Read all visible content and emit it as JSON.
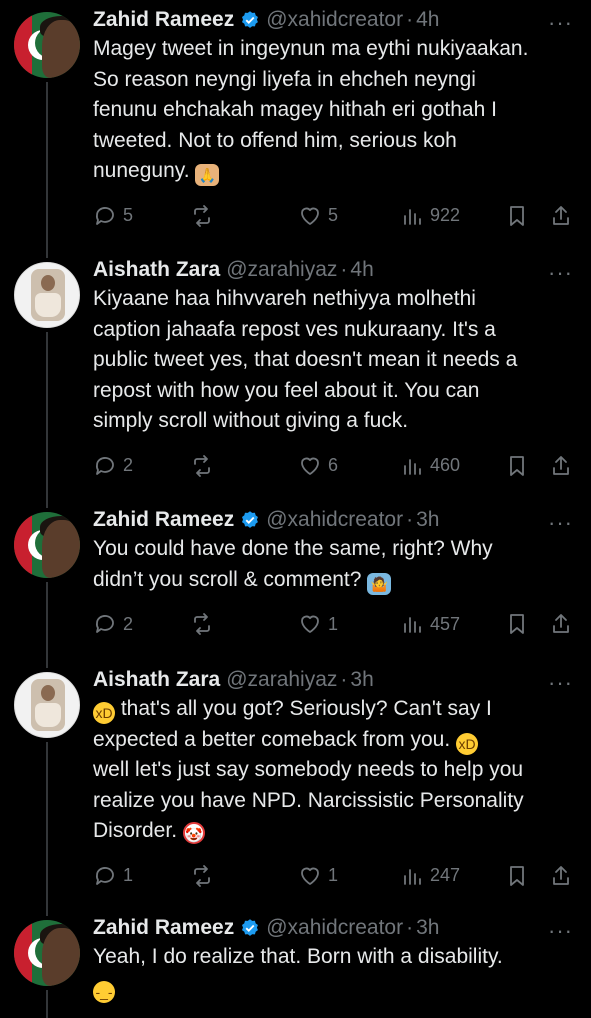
{
  "tweets": [
    {
      "name": "Zahid Rameez",
      "verified": true,
      "handle": "@xahidcreator",
      "time": "4h",
      "avatar": "zahid",
      "lines": [
        "Magey tweet in ingeynun ma eythi nukiyaakan.",
        "So reason neyngi liyefa in ehcheh neyngi",
        "fenunu ehchakah magey hithah eri gothah I",
        "tweeted. Not to offend him, serious koh",
        "nuneguny."
      ],
      "emoji": [
        {
          "line": 4,
          "name": "folded-hands-emoji"
        }
      ],
      "replies": "5",
      "likes": "5",
      "views": "922"
    },
    {
      "name": "Aishath Zara",
      "verified": false,
      "handle": "@zarahiyaz",
      "time": "4h",
      "avatar": "zara",
      "lines": [
        "Kiyaane haa hihvvareh nethiyya molhethi",
        "caption jahaafa repost ves nukuraany. It's a",
        "public tweet yes, that doesn't mean it needs a",
        "repost with how you feel about it. You can",
        "simply scroll without giving a fuck."
      ],
      "emoji": [],
      "replies": "2",
      "likes": "6",
      "views": "460"
    },
    {
      "name": "Zahid Rameez",
      "verified": true,
      "handle": "@xahidcreator",
      "time": "3h",
      "avatar": "zahid",
      "lines": [
        "You could have done the same, right? Why",
        "didn’t you scroll & comment?"
      ],
      "emoji": [
        {
          "line": 1,
          "name": "person-shrugging-emoji"
        }
      ],
      "replies": "2",
      "likes": "1",
      "views": "457"
    },
    {
      "name": "Aishath Zara",
      "verified": false,
      "handle": "@zarahiyaz",
      "time": "3h",
      "avatar": "zara",
      "lines": [
        "that's all you got? Seriously? Can't say I",
        "expected a better comeback from you.",
        "well let's just say somebody needs to help you",
        "realize you have NPD. Narcissistic Personality",
        "Disorder."
      ],
      "emoji": [
        {
          "line": 0,
          "name": "grinning-squinting-emoji",
          "position": "start"
        },
        {
          "line": 1,
          "name": "grinning-squinting-emoji"
        },
        {
          "line": 4,
          "name": "clown-face-emoji"
        }
      ],
      "replies": "1",
      "likes": "1",
      "views": "247"
    },
    {
      "name": "Zahid Rameez",
      "verified": true,
      "handle": "@xahidcreator",
      "time": "3h",
      "avatar": "zahid",
      "lines": [
        "Yeah, I do realize that. Born with a disability.",
        ""
      ],
      "emoji": [
        {
          "line": 1,
          "name": "unamused-face-emoji",
          "position": "start"
        }
      ],
      "replies": null,
      "likes": null,
      "views": null
    }
  ],
  "separator": "·",
  "more_label": "···",
  "colors": {
    "text": "#e7e9ea",
    "muted": "#71767b",
    "verified": "#1d9bf0",
    "background": "#000000"
  }
}
